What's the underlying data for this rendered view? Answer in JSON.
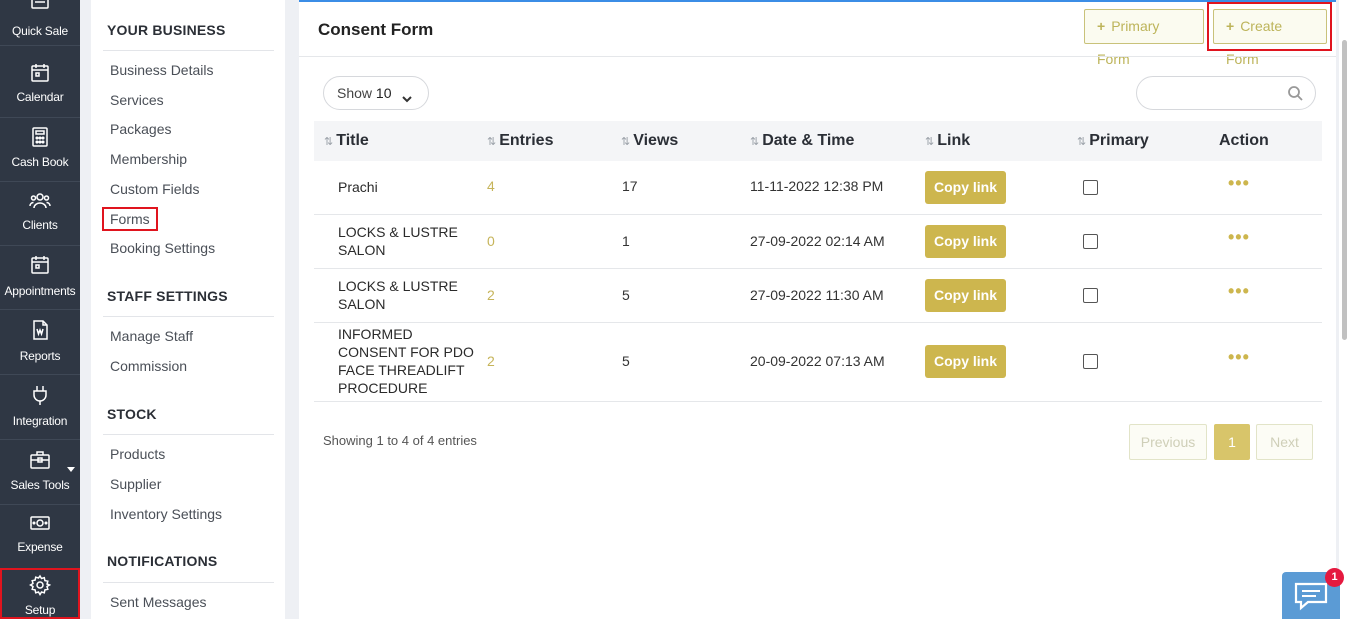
{
  "rail": {
    "items": [
      {
        "label": "Quick Sale"
      },
      {
        "label": "Calendar"
      },
      {
        "label": "Cash Book"
      },
      {
        "label": "Clients"
      },
      {
        "label": "Appointments"
      },
      {
        "label": "Reports"
      },
      {
        "label": "Integration"
      },
      {
        "label": "Sales Tools"
      },
      {
        "label": "Expense"
      },
      {
        "label": "Setup"
      }
    ]
  },
  "subnav": {
    "your_business": "YOUR BUSINESS",
    "business_items": [
      "Business Details",
      "Services",
      "Packages",
      "Membership",
      "Custom Fields",
      "Forms",
      "Booking Settings"
    ],
    "staff_settings": "STAFF SETTINGS",
    "staff_items": [
      "Manage Staff",
      "Commission"
    ],
    "stock": "STOCK",
    "stock_items": [
      "Products",
      "Supplier",
      "Inventory Settings"
    ],
    "notifications": "NOTIFICATIONS",
    "notification_items": [
      "Sent Messages"
    ]
  },
  "main": {
    "title": "Consent Form",
    "primary_form_btn": "Primary Form",
    "create_form_btn": "Create Form",
    "show_label": "Show",
    "show_value": "10",
    "search_placeholder": "",
    "columns": [
      "Title",
      "Entries",
      "Views",
      "Date & Time",
      "Link",
      "Primary",
      "Action"
    ],
    "rows": [
      {
        "title": "Prachi",
        "entries": "4",
        "views": "17",
        "datetime": "11-11-2022 12:38 PM",
        "link": "Copy link",
        "primary": false
      },
      {
        "title": "LOCKS & LUSTRE SALON",
        "entries": "0",
        "views": "1",
        "datetime": "27-09-2022 02:14 AM",
        "link": "Copy link",
        "primary": false
      },
      {
        "title": "LOCKS & LUSTRE SALON",
        "entries": "2",
        "views": "5",
        "datetime": "27-09-2022 11:30 AM",
        "link": "Copy link",
        "primary": false
      },
      {
        "title": "INFORMED CONSENT FOR PDO FACE THREADLIFT PROCEDURE",
        "entries": "2",
        "views": "5",
        "datetime": "20-09-2022 07:13 AM",
        "link": "Copy link",
        "primary": false
      }
    ],
    "action_dots": "•••",
    "showing_text": "Showing 1 to 4 of 4 entries",
    "pagination": {
      "previous": "Previous",
      "current": "1",
      "next": "Next"
    }
  },
  "chat": {
    "badge": "1"
  },
  "colors": {
    "rail_bg": "#2f3744",
    "accent_gold": "#cdb64e",
    "highlight_red": "#e0141e",
    "top_border_blue": "#3b8de6"
  }
}
